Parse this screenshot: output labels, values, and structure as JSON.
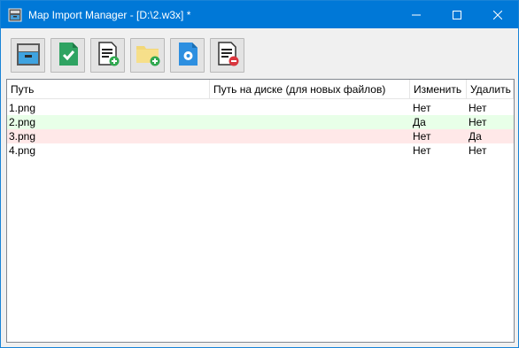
{
  "window": {
    "title": "Map Import Manager - [D:\\2.w3x] *",
    "accent": "#0078d7"
  },
  "toolbar": {
    "buttons": [
      {
        "icon": "archive-drawer-icon"
      },
      {
        "icon": "document-check-icon"
      },
      {
        "icon": "document-add-icon"
      },
      {
        "icon": "folder-add-icon"
      },
      {
        "icon": "document-settings-icon"
      },
      {
        "icon": "document-remove-icon"
      }
    ]
  },
  "table": {
    "columns": [
      "Путь",
      "Путь на диске (для новых файлов)",
      "Изменить",
      "Удалить"
    ],
    "rows": [
      {
        "path": "1.png",
        "disk_path": "",
        "modify": "Нет",
        "delete": "Нет",
        "status_color": "#ffffff"
      },
      {
        "path": "2.png",
        "disk_path": "",
        "modify": "Да",
        "delete": "Нет",
        "status_color": "#e8ffe8"
      },
      {
        "path": "3.png",
        "disk_path": "",
        "modify": "Нет",
        "delete": "Да",
        "status_color": "#ffe8e8"
      },
      {
        "path": "4.png",
        "disk_path": "",
        "modify": "Нет",
        "delete": "Нет",
        "status_color": "#ffffff"
      }
    ]
  }
}
